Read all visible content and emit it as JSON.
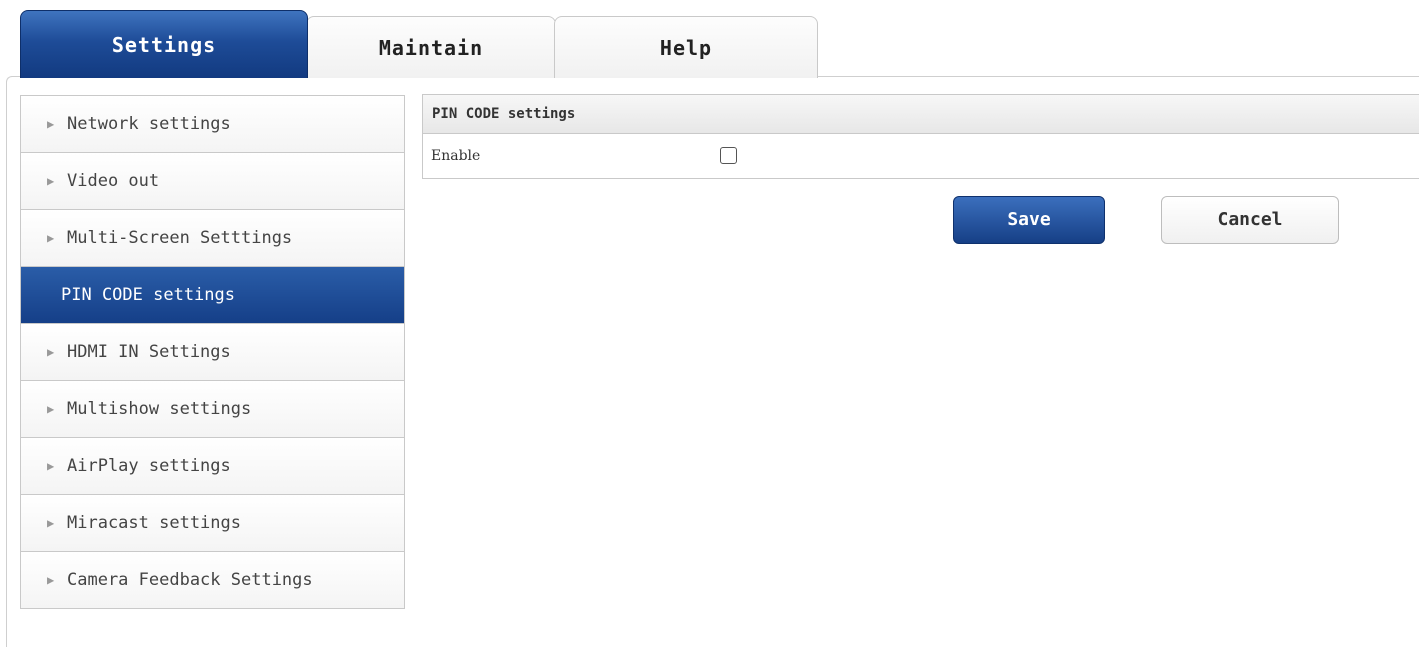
{
  "tabs": [
    {
      "label": "Settings",
      "active": true
    },
    {
      "label": "Maintain",
      "active": false
    },
    {
      "label": "Help",
      "active": false
    }
  ],
  "sidebar": {
    "arrow_icon": "▶",
    "items": [
      {
        "label": "Network settings",
        "active": false
      },
      {
        "label": "Video out",
        "active": false
      },
      {
        "label": "Multi-Screen Setttings",
        "active": false
      },
      {
        "label": "PIN CODE settings",
        "active": true
      },
      {
        "label": "HDMI IN Settings",
        "active": false
      },
      {
        "label": "Multishow settings",
        "active": false
      },
      {
        "label": "AirPlay settings",
        "active": false
      },
      {
        "label": "Miracast settings",
        "active": false
      },
      {
        "label": "Camera Feedback Settings",
        "active": false
      }
    ]
  },
  "panel": {
    "title": "PIN CODE settings",
    "rows": [
      {
        "label": "Enable",
        "checked": false
      }
    ]
  },
  "buttons": {
    "save_label": "Save",
    "cancel_label": "Cancel"
  },
  "colors": {
    "accent": "#1e4c98",
    "active_tab_text": "#ffffff"
  }
}
